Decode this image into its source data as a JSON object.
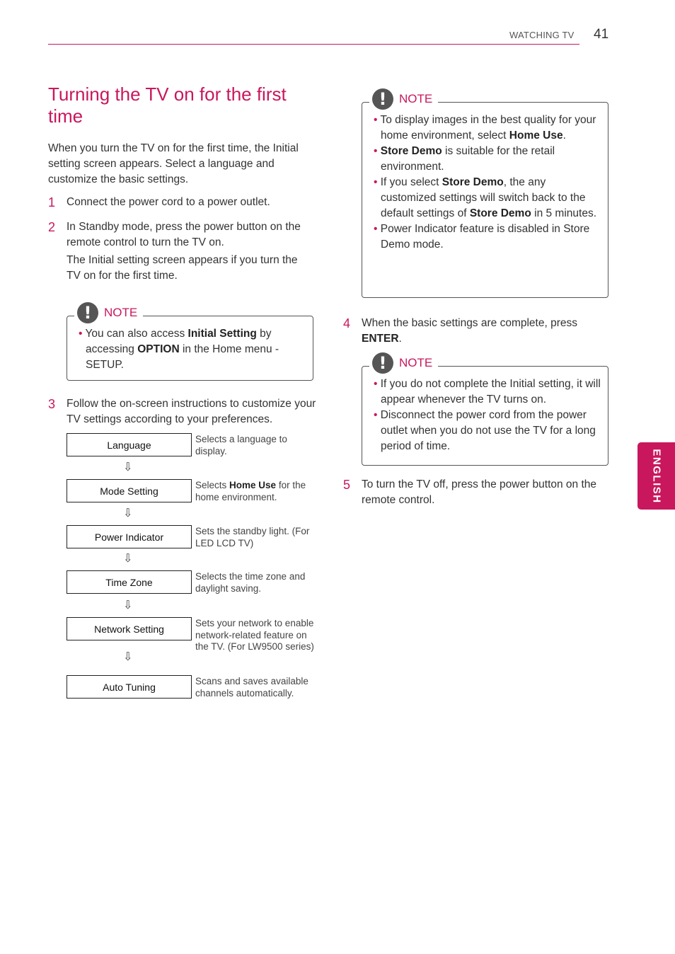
{
  "header": {
    "section": "WATCHING TV",
    "page_number": "41"
  },
  "title": "Turning the TV on for the first time",
  "intro": "When you turn the TV on for the first time, the Initial setting screen appears. Select a language and customize the basic settings.",
  "steps": [
    {
      "num": "1",
      "text": "Connect the power cord to a power outlet."
    },
    {
      "num": "2",
      "text": "In Standby mode, press the power button on the remote control to turn the TV on.",
      "subtext": "The Initial setting screen appears if you turn the TV on for the first time."
    },
    {
      "num": "3",
      "text": "Follow the on-screen instructions to customize your TV settings according to your preferences."
    },
    {
      "num": "4",
      "text_before": "When the basic settings are complete, press ",
      "bold": "ENTER",
      "text_after": "."
    },
    {
      "num": "5",
      "text": "To turn the TV off, press the power button on the remote control."
    }
  ],
  "note_label": "NOTE",
  "note1": {
    "items": [
      {
        "parts": [
          {
            "t": "You can also access "
          },
          {
            "b": "Initial Setting"
          },
          {
            "t": " by accessing "
          },
          {
            "b": "OPTION"
          },
          {
            "t": " in the Home menu - SETUP."
          }
        ]
      }
    ]
  },
  "note2": {
    "items": [
      {
        "parts": [
          {
            "t": "To display images in the best quality for your home environment, select "
          },
          {
            "b": "Home Use"
          },
          {
            "t": "."
          }
        ]
      },
      {
        "parts": [
          {
            "b": "Store Demo"
          },
          {
            "t": " is suitable for the retail environment."
          }
        ]
      },
      {
        "parts": [
          {
            "t": "If you select "
          },
          {
            "b": "Store Demo"
          },
          {
            "t": ", the any customized settings will switch back to the default settings of "
          },
          {
            "b": "Store Demo"
          },
          {
            "t": " in 5 minutes."
          }
        ]
      },
      {
        "parts": [
          {
            "t": "Power Indicator feature is disabled in Store Demo mode."
          }
        ]
      }
    ]
  },
  "note3": {
    "items": [
      {
        "parts": [
          {
            "t": "If you do not complete the Initial setting, it will appear whenever the TV turns on."
          }
        ]
      },
      {
        "parts": [
          {
            "t": "Disconnect the power cord from the power outlet when you do not use the TV for a long period of time."
          }
        ]
      }
    ]
  },
  "flow": [
    {
      "label": "Language",
      "desc": [
        {
          "t": "Selects a language to display."
        }
      ]
    },
    {
      "label": "Mode Setting",
      "desc": [
        {
          "t": "Selects "
        },
        {
          "b": "Home Use"
        },
        {
          "t": " for the home environment."
        }
      ]
    },
    {
      "label": "Power Indicator",
      "desc": [
        {
          "t": "Sets the standby light. (For LED LCD TV)"
        }
      ]
    },
    {
      "label": "Time Zone",
      "desc": [
        {
          "t": "Selects the time zone and daylight saving."
        }
      ]
    },
    {
      "label": "Network Setting",
      "desc": [
        {
          "t": "Sets your network to enable network-related feature on the TV. (For LW9500 series)"
        }
      ]
    },
    {
      "label": "Auto Tuning",
      "desc": [
        {
          "t": "Scans and saves available channels automatically."
        }
      ]
    }
  ],
  "flow_arrow": "⇩",
  "side_tab": "ENGLISH",
  "colors": {
    "accent": "#c8175d",
    "text": "#333333",
    "icon": "#555555"
  }
}
